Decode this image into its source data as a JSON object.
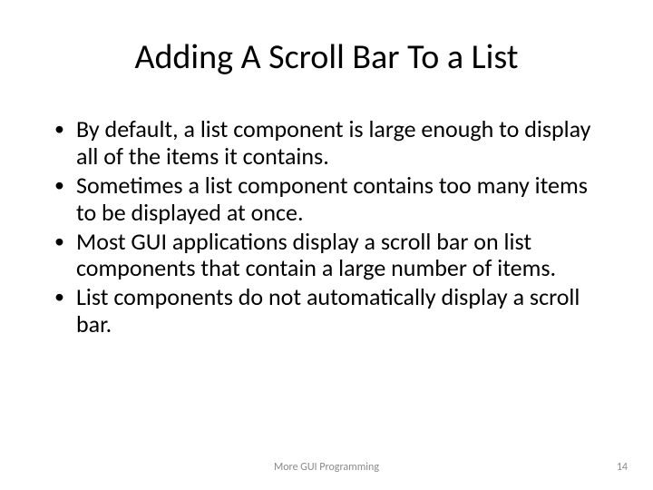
{
  "title": "Adding A Scroll Bar To a List",
  "bullets": [
    "By default, a list component is large enough to display all of the items it contains.",
    "Sometimes a list component contains too many items to be displayed at once.",
    "Most GUI applications display a scroll bar on list components that contain a large number of items.",
    "List components do not automatically display a scroll bar."
  ],
  "footer": {
    "center": "More GUI Programming",
    "page": "14"
  }
}
